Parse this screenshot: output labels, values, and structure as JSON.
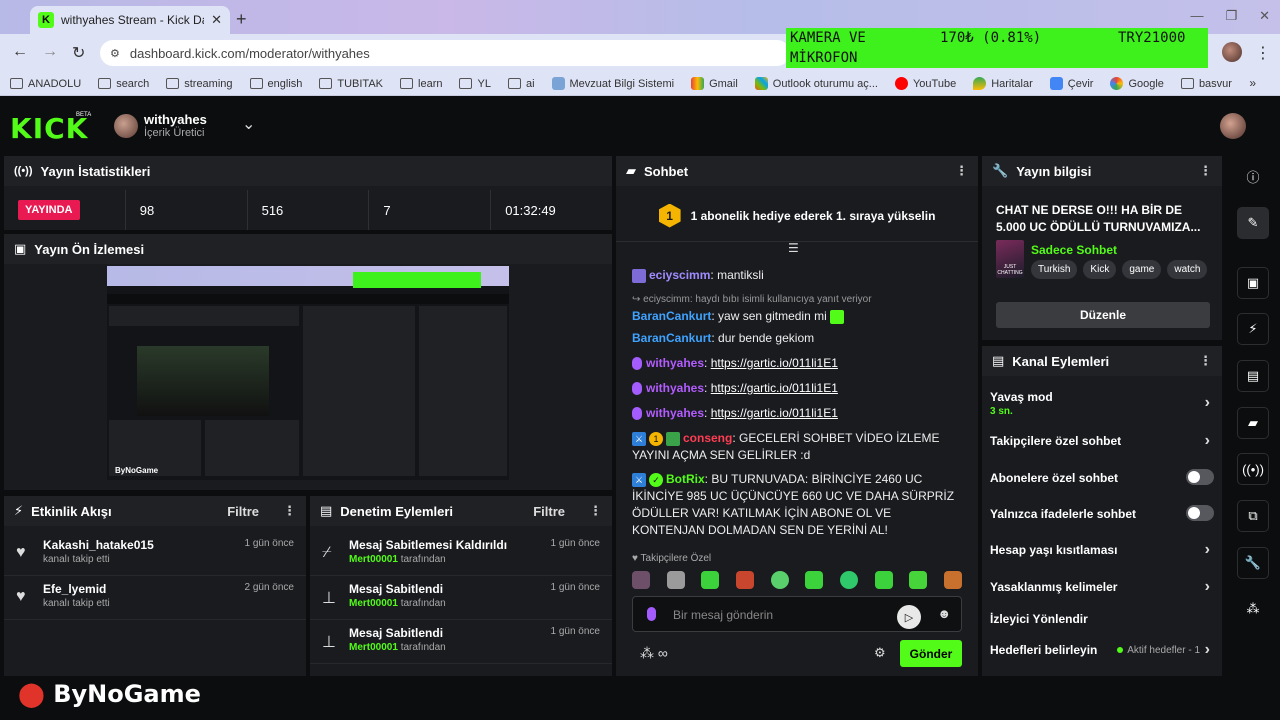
{
  "browser": {
    "tab_title": "withyahes Stream - Kick Dashbo",
    "url": "dashboard.kick.com/moderator/withyahes",
    "ticker": {
      "label": "KAMERA VE MİKROFON",
      "price": "170₺ (0.81%)",
      "total": "TRY21000"
    },
    "bookmarks": [
      "ANADOLU",
      "search",
      "streaming",
      "english",
      "TUBITAK",
      "learn",
      "YL",
      "ai",
      "Mevzuat Bilgi Sistemi",
      "Gmail",
      "Outlook oturumu aç...",
      "YouTube",
      "Haritalar",
      "Çevir",
      "Google",
      "basvur"
    ]
  },
  "header": {
    "logo": "KICK",
    "beta": "BETA",
    "channel_name": "withyahes",
    "channel_role": "İçerik Üretici"
  },
  "stats": {
    "title": "Yayın İstatistikleri",
    "status": "YAYINDA",
    "values": [
      "98",
      "516",
      "7",
      "01:32:49"
    ]
  },
  "preview": {
    "title": "Yayın Ön İzlemesi",
    "watermark": "ByNoGame"
  },
  "activity": {
    "title": "Etkinlik Akışı",
    "filter": "Filtre",
    "items": [
      {
        "name": "Kakashi_hatake015",
        "desc": "kanalı takip etti",
        "time": "1 gün önce"
      },
      {
        "name": "Efe_lyemid",
        "desc": "kanalı takip etti",
        "time": "2 gün önce"
      }
    ]
  },
  "moderation": {
    "title": "Denetim Eylemleri",
    "filter": "Filtre",
    "items": [
      {
        "action": "Mesaj Sabitlemesi Kaldırıldı",
        "user": "Mert00001",
        "suffix": "tarafından",
        "time": "1 gün önce"
      },
      {
        "action": "Mesaj Sabitlendi",
        "user": "Mert00001",
        "suffix": "tarafından",
        "time": "1 gün önce"
      },
      {
        "action": "Mesaj Sabitlendi",
        "user": "Mert00001",
        "suffix": "tarafından",
        "time": "1 gün önce"
      }
    ]
  },
  "chat": {
    "title": "Sohbet",
    "banner_num": "1",
    "banner": "1 abonelik hediye ederek 1. sıraya yükselin",
    "messages": [
      {
        "user": "eciyscimm",
        "sep": ":",
        "text": "mantiksli"
      },
      {
        "reply": "eciyscimm: haydı bıbı isimli kullanıcıya yanıt veriyor",
        "user": "BaranCankurt",
        "sep": ":",
        "text": "yaw sen gitmedin mi"
      },
      {
        "user": "BaranCankurt",
        "sep": ":",
        "text": "dur bende gekiom"
      },
      {
        "user": "withyahes",
        "sep": ":",
        "text": "https://gartic.io/011li1E1"
      },
      {
        "user": "withyahes",
        "sep": ":",
        "text": "https://gartic.io/011li1E1"
      },
      {
        "user": "withyahes",
        "sep": ":",
        "text": "https://gartic.io/011li1E1"
      },
      {
        "user": "conseng",
        "sep": ":",
        "text": "GECELERİ SOHBET VİDEO İZLEME YAYINI AÇMA SEN GELİRLER :d",
        "badge_num": "1"
      },
      {
        "user": "BotRix",
        "sep": ":",
        "text": "BU TURNUVADA: BİRİNCİYE 2460 UC İKİNCİYE 985 UC ÜÇÜNCÜYE 660 UC VE DAHA SÜRPRİZ ÖDÜLLER VAR! KATILMAK İÇİN ABONE OL VE KONTENJAN DOLMADAN SEN DE YERİNİ AL!"
      }
    ],
    "followers_only": "Takipçilere Özel",
    "placeholder": "Bir mesaj gönderin",
    "send": "Gönder"
  },
  "info": {
    "title": "Yayın bilgisi",
    "stream_title": "CHAT NE DERSE O!!! HA BİR DE 5.000 UC ÖDÜLLÜ TURNUVAMIZA...",
    "category": "Sadece Sohbet",
    "thumb_text": "JUST CHATTING",
    "tags": [
      "Turkish",
      "Kick",
      "game",
      "watch"
    ],
    "edit": "Düzenle"
  },
  "actions": {
    "title": "Kanal Eylemleri",
    "slow_mode": "Yavaş mod",
    "slow_value": "3 sn.",
    "followers_chat": "Takipçilere özel sohbet",
    "subscribers_chat": "Abonelere özel sohbet",
    "emotes_chat": "Yalnızca ifadelerle sohbet",
    "account_age": "Hesap yaşı kısıtlaması",
    "banned_words": "Yasaklanmış kelimeler",
    "redirect": "İzleyici Yönlendir",
    "goals": "Hedefleri belirleyin",
    "goals_sub": "Aktif hedefler - 1"
  },
  "footer": {
    "brand": "ByNoGame"
  },
  "colors": {
    "accent": "#53fc18",
    "live": "#e91951",
    "panel": "#191b1f"
  }
}
